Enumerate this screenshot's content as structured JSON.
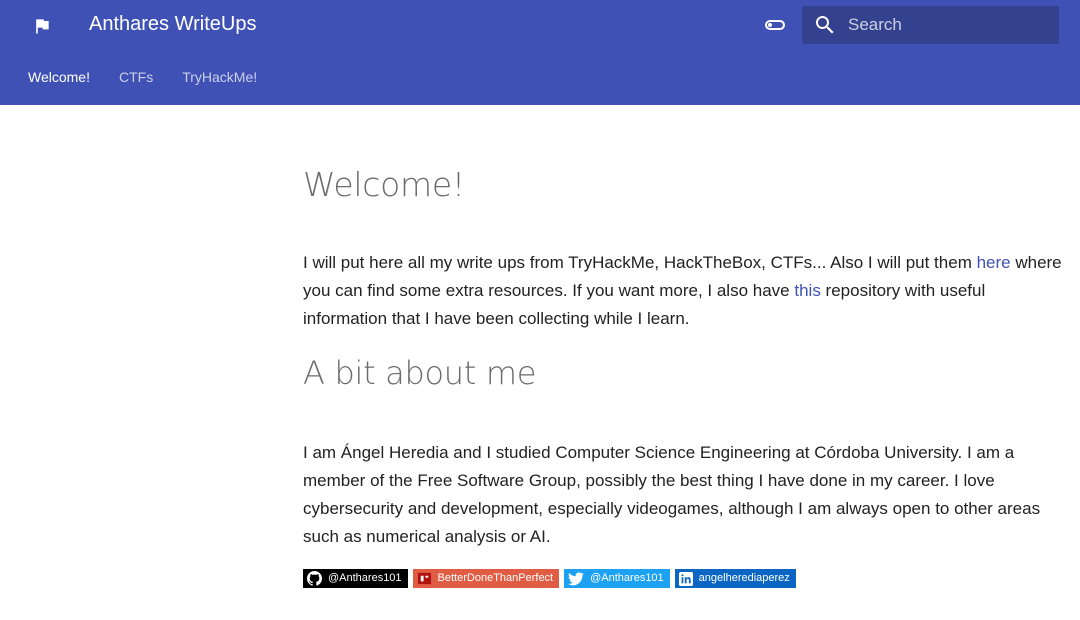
{
  "header": {
    "site_title": "Anthares WriteUps",
    "search_placeholder": "Search",
    "accent_color": "#4051b5",
    "logo_icon": "flag-icon"
  },
  "tabs": [
    {
      "label": "Welcome!",
      "active": true
    },
    {
      "label": "CTFs",
      "active": false
    },
    {
      "label": "TryHackMe!",
      "active": false
    }
  ],
  "main": {
    "title": "Welcome!",
    "intro": {
      "part1": "I will put here all my write ups from TryHackMe, HackTheBox, CTFs... Also I will put them ",
      "link1": "here",
      "part2": " where you can find some extra resources. If you want more, I also have ",
      "link2": "this",
      "part3": " repository with useful information that I have been collecting while I learn."
    },
    "about_heading": "A bit about me",
    "about_text": "I am Ángel Heredia and I studied Computer Science Engineering at Córdoba University. I am a member of the Free Software Group, possibly the best thing I have done in my career. I love cybersecurity and development, especially videogames, although I am always open to other areas such as numerical analysis or AI."
  },
  "badges": [
    {
      "label": "@Anthares101",
      "icon": "github-icon",
      "color": "#000000"
    },
    {
      "label": "BetterDoneThanPerfect",
      "icon": "blog-icon",
      "color": "#e05d44"
    },
    {
      "label": "@Anthares101",
      "icon": "twitter-icon",
      "color": "#1da1f2"
    },
    {
      "label": "angelherediaperez",
      "icon": "linkedin-icon",
      "color": "#0a66c2"
    }
  ]
}
